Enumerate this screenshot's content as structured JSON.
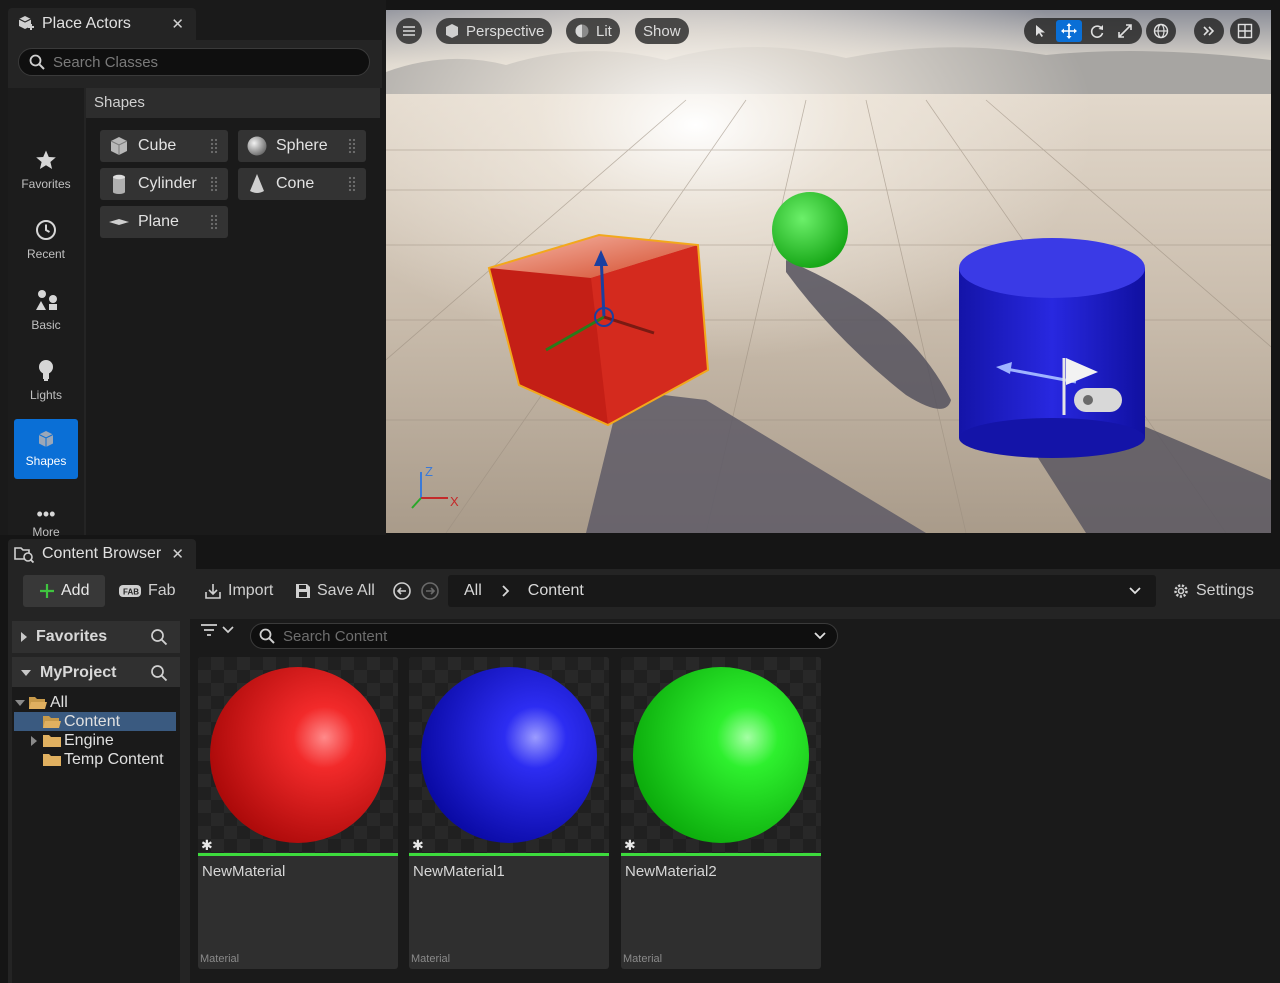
{
  "place_actors": {
    "tab_title": "Place Actors",
    "search_placeholder": "Search Classes",
    "categories": [
      {
        "label": "Favorites",
        "icon": "star-icon"
      },
      {
        "label": "Recent",
        "icon": "clock-icon"
      },
      {
        "label": "Basic",
        "icon": "basic-shapes-icon"
      },
      {
        "label": "Lights",
        "icon": "lightbulb-icon"
      },
      {
        "label": "Shapes",
        "icon": "cube-icon",
        "active": true
      },
      {
        "label": "More",
        "icon": "ellipsis-icon"
      }
    ],
    "section_title": "Shapes",
    "shapes": [
      {
        "label": "Cube",
        "icon": "cube-icon"
      },
      {
        "label": "Sphere",
        "icon": "sphere-icon"
      },
      {
        "label": "Cylinder",
        "icon": "cylinder-icon"
      },
      {
        "label": "Cone",
        "icon": "cone-icon"
      },
      {
        "label": "Plane",
        "icon": "plane-icon"
      }
    ]
  },
  "viewport": {
    "perspective_label": "Perspective",
    "lit_label": "Lit",
    "show_label": "Show",
    "axis_labels": {
      "z": "Z",
      "x": "X"
    },
    "accent": "#0a6fd6",
    "objects": [
      {
        "name": "red cube",
        "color": "#d42a1e"
      },
      {
        "name": "green sphere",
        "color": "#2ecc2a"
      },
      {
        "name": "blue cylinder",
        "color": "#1f1fd0"
      }
    ]
  },
  "content_browser": {
    "tab_title": "Content Browser",
    "toolbar": {
      "add": "Add",
      "fab": "Fab",
      "import": "Import",
      "save_all": "Save All",
      "settings": "Settings"
    },
    "path": [
      "All",
      "Content"
    ],
    "sources": {
      "favorites": "Favorites",
      "project": "MyProject",
      "tree": [
        {
          "label": "All",
          "expanded": true
        },
        {
          "label": "Content",
          "selected": true
        },
        {
          "label": "Engine"
        },
        {
          "label": "Temp Content"
        }
      ]
    },
    "search_placeholder": "Search Content",
    "assets": [
      {
        "name": "NewMaterial",
        "type": "Material",
        "color": "#e51b1b"
      },
      {
        "name": "NewMaterial1",
        "type": "Material",
        "color": "#1b1be0"
      },
      {
        "name": "NewMaterial2",
        "type": "Material",
        "color": "#1fe01f"
      }
    ]
  }
}
